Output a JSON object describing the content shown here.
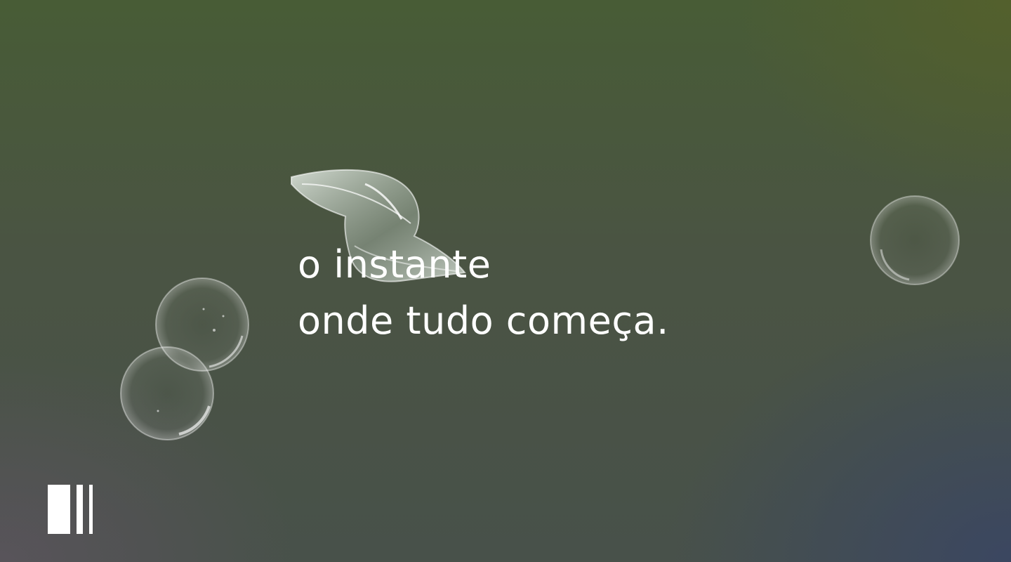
{
  "hero": {
    "headline_line1": "o instante",
    "headline_line2": "onde tudo começa."
  },
  "controls": {
    "pause_icon": "pause-bars-icon"
  },
  "colors": {
    "text": "#ffffff",
    "background_top": "#485c36",
    "background_bottom_right": "#3a4662"
  }
}
